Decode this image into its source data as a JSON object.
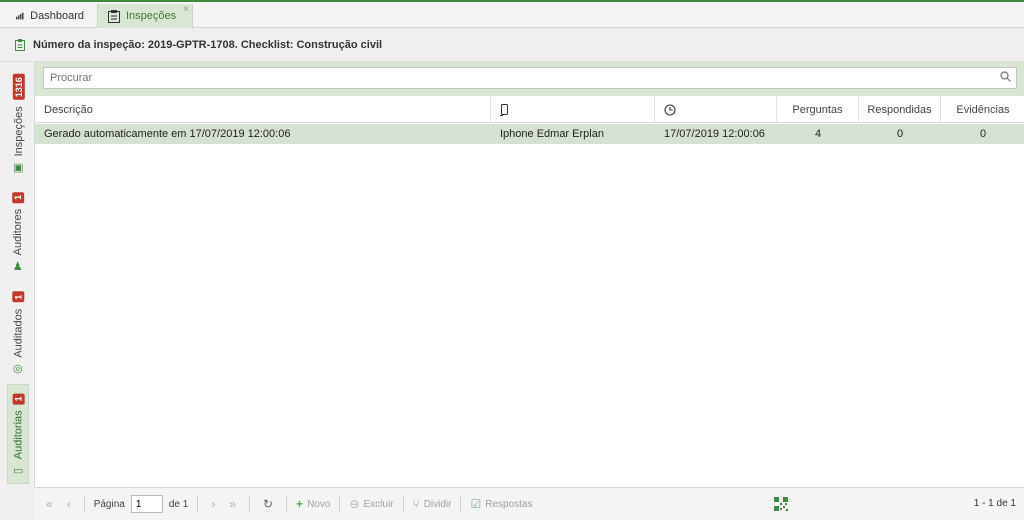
{
  "tabs": {
    "dashboard": "Dashboard",
    "inspecoes": "Inspeções",
    "close": "×"
  },
  "header": {
    "title": "Número da inspeção: 2019-GPTR-1708. Checklist: Construção civil"
  },
  "sidebar": {
    "inspecoes": {
      "label": "Inspeções",
      "badge": "1316"
    },
    "auditores": {
      "label": "Auditores",
      "badge": "1"
    },
    "auditados": {
      "label": "Auditados",
      "badge": "1"
    },
    "auditorias": {
      "label": "Auditorias",
      "badge": "1"
    }
  },
  "search": {
    "placeholder": "Procurar"
  },
  "table": {
    "headers": {
      "descricao": "Descrição",
      "perguntas": "Perguntas",
      "respondidas": "Respondidas",
      "evidencias": "Evidências"
    },
    "rows": [
      {
        "descricao": "Gerado automaticamente em 17/07/2019 12:00:06",
        "dispositivo": "Iphone Edmar Erplan",
        "data": "17/07/2019 12:00:06",
        "perguntas": "4",
        "respondidas": "0",
        "evidencias": "0"
      }
    ]
  },
  "footer": {
    "pagina_label": "Página",
    "pagina_value": "1",
    "de_label": "de 1",
    "novo": "Novo",
    "excluir": "Excluir",
    "dividir": "Dividir",
    "respostas": "Respostas",
    "range": "1 - 1 de 1"
  },
  "colors": {
    "accent": "#3d8a3d",
    "row_selected": "#d5e2d1",
    "badge": "#c0392b"
  }
}
